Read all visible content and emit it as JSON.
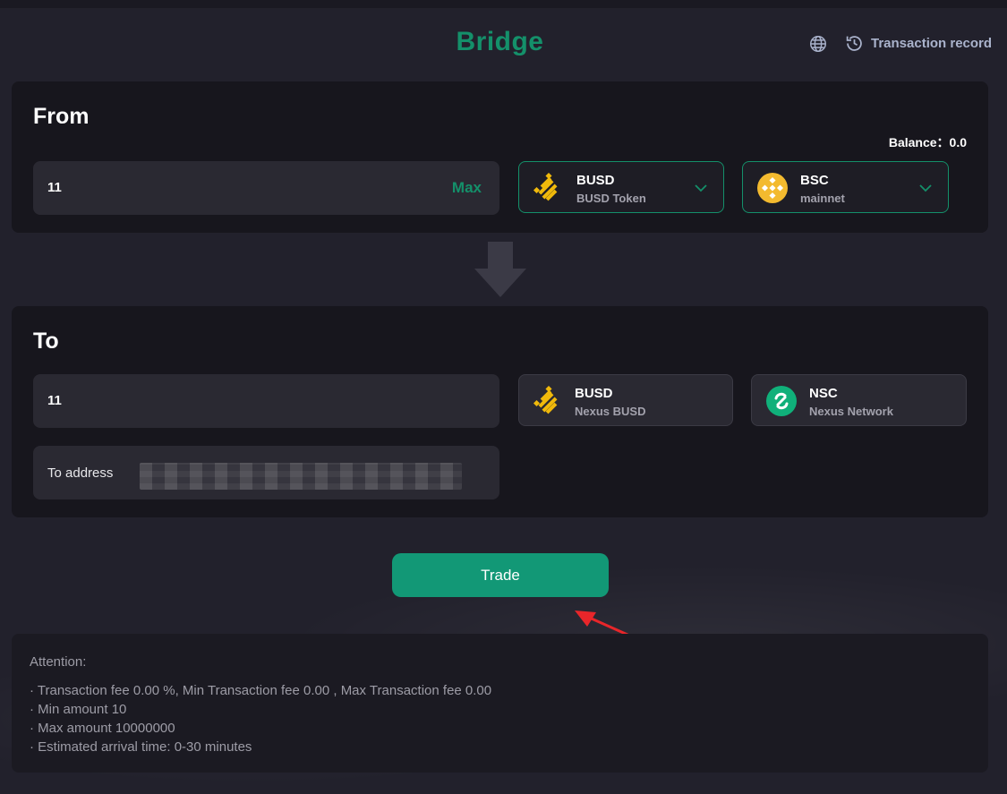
{
  "header": {
    "title": "Bridge",
    "language_icon": "globe-icon",
    "record_icon": "history-clock-icon",
    "record_label": "Transaction record"
  },
  "from": {
    "title": "From",
    "balance_label": "Balance：",
    "balance_value": "0.0",
    "amount": "11",
    "max_label": "Max",
    "token": {
      "name": "BUSD",
      "sub": "BUSD Token",
      "icon": "busd-icon"
    },
    "network": {
      "name": "BSC",
      "sub": "mainnet",
      "icon": "bnb-icon"
    }
  },
  "to": {
    "title": "To",
    "amount": "11",
    "token": {
      "name": "BUSD",
      "sub": "Nexus BUSD",
      "icon": "busd-icon"
    },
    "network": {
      "name": "NSC",
      "sub": "Nexus Network",
      "icon": "nexus-icon"
    },
    "address_label": "To address"
  },
  "trade_label": "Trade",
  "attention": {
    "title": "Attention:",
    "items": [
      "· Transaction fee 0.00 %, Min Transaction fee 0.00 , Max Transaction fee 0.00",
      "· Min amount 10",
      "· Max amount 10000000",
      "· Estimated arrival time: 0-30 minutes"
    ]
  },
  "colors": {
    "accent": "#14906a",
    "button": "#129876",
    "background": "#22212c",
    "card": "#17161d",
    "busd": "#f0b90b"
  }
}
